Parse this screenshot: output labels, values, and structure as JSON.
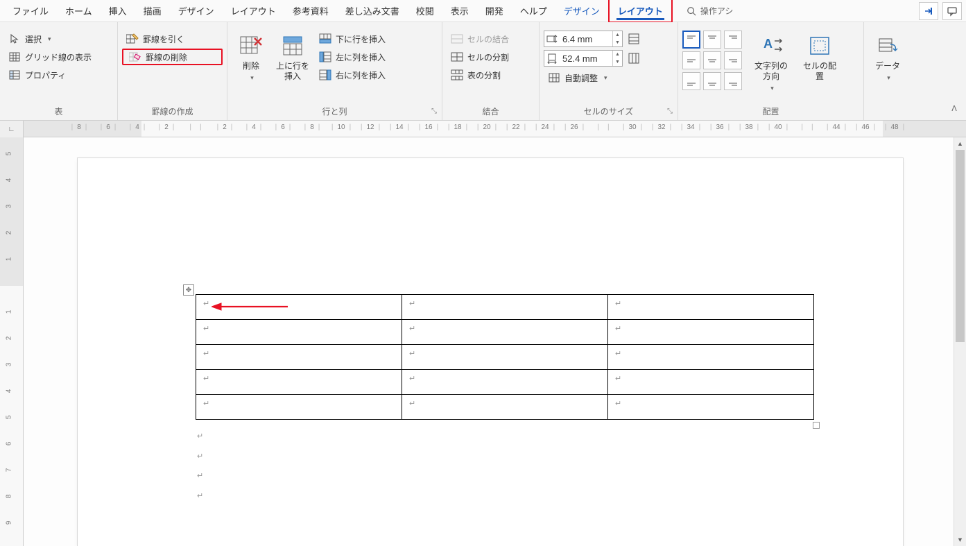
{
  "menubar": {
    "tabs": [
      {
        "label": "ファイル"
      },
      {
        "label": "ホーム"
      },
      {
        "label": "挿入"
      },
      {
        "label": "描画"
      },
      {
        "label": "デザイン"
      },
      {
        "label": "レイアウト"
      },
      {
        "label": "参考資料"
      },
      {
        "label": "差し込み文書"
      },
      {
        "label": "校閲"
      },
      {
        "label": "表示"
      },
      {
        "label": "開発"
      },
      {
        "label": "ヘルプ"
      },
      {
        "label": "デザイン",
        "context": true
      },
      {
        "label": "レイアウト",
        "active": true,
        "highlight": true
      }
    ],
    "search_placeholder": "操作アシ"
  },
  "ribbon": {
    "groups": {
      "table": {
        "label": "表",
        "select": "選択",
        "gridlines": "グリッド線の表示",
        "properties": "プロパティ"
      },
      "draw": {
        "label": "罫線の作成",
        "draw": "罫線を引く",
        "erase": "罫線の削除"
      },
      "rowscols": {
        "label": "行と列",
        "delete": "削除",
        "insert_above": "上に行を挿入",
        "insert_below": "下に行を挿入",
        "insert_left": "左に列を挿入",
        "insert_right": "右に列を挿入"
      },
      "merge": {
        "label": "結合",
        "merge_cells": "セルの結合",
        "split_cells": "セルの分割",
        "split_table": "表の分割"
      },
      "cellsize": {
        "label": "セルのサイズ",
        "height": "6.4 mm",
        "width": "52.4 mm",
        "autofit": "自動調整"
      },
      "alignment": {
        "label": "配置",
        "text_direction": "文字列の方向",
        "cell_margins": "セルの配置"
      },
      "data": {
        "label": "",
        "data_btn": "データ"
      }
    }
  },
  "h_ruler": {
    "ticks": [
      "8",
      "6",
      "4",
      "2",
      "",
      "2",
      "4",
      "6",
      "8",
      "10",
      "12",
      "14",
      "16",
      "18",
      "20",
      "22",
      "24",
      "26",
      "",
      "30",
      "32",
      "34",
      "36",
      "38",
      "40",
      "",
      "44",
      "46",
      "48"
    ]
  },
  "v_ruler": {
    "ticks": [
      "5",
      "4",
      "3",
      "2",
      "1",
      "",
      "1",
      "2",
      "3",
      "4",
      "5",
      "6",
      "7",
      "8",
      "9"
    ]
  },
  "annotations": {
    "layout_tab_highlight": true,
    "erase_borders_highlight": true,
    "arrow_in_cell": true
  },
  "table": {
    "rows": 5,
    "cols": 3
  }
}
